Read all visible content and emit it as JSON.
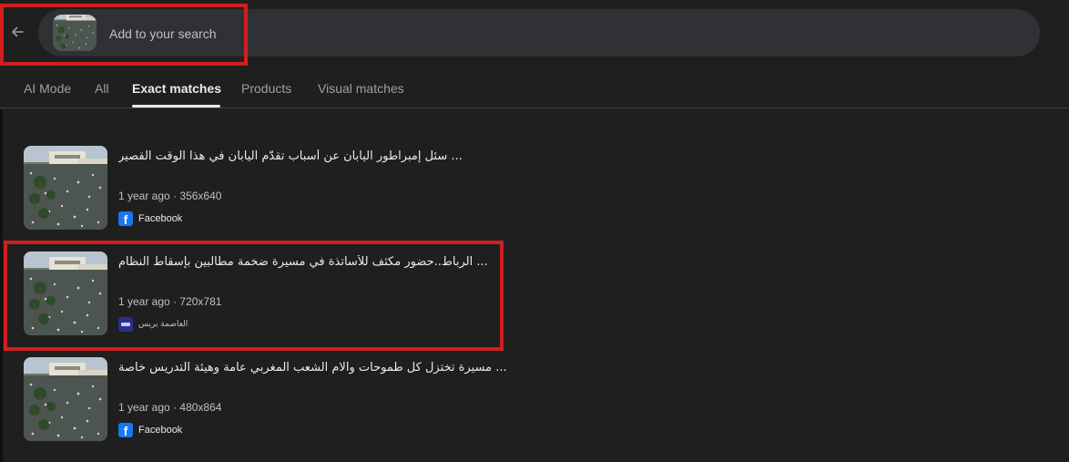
{
  "search": {
    "placeholder": "Add to your search",
    "back_icon": "arrow-left-icon"
  },
  "tabs": [
    {
      "label": "AI Mode",
      "active": false
    },
    {
      "label": "All",
      "active": false
    },
    {
      "label": "Exact matches",
      "active": true
    },
    {
      "label": "Products",
      "active": false
    },
    {
      "label": "Visual matches",
      "active": false
    }
  ],
  "results": [
    {
      "title": "سئل إمبراطور اليابان عن أسباب تقدّم اليابان في هذا الوقت القصير ...",
      "age": "1 year ago",
      "dimensions": "356x640",
      "source": "Facebook",
      "source_icon": "facebook-icon"
    },
    {
      "title": "الرباط..حضور مكثف للأساتذة في مسيرة ضخمة مطالبين بإسقاط النظام ...",
      "age": "1 year ago",
      "dimensions": "720x781",
      "source": "العاصمة بريس",
      "source_icon": "site-favicon-icon"
    },
    {
      "title": "مسيرة تختزل كل طموحات وآلام الشعب المغربي عامة وهيئة التدريس خاصة ...",
      "age": "1 year ago",
      "dimensions": "480x864",
      "source": "Facebook",
      "source_icon": "facebook-icon"
    }
  ],
  "meta_separator": "·",
  "colors": {
    "background": "#1f1f1f",
    "search_pill": "#303134",
    "highlight": "#d11f1f",
    "facebook": "#1877f2"
  }
}
